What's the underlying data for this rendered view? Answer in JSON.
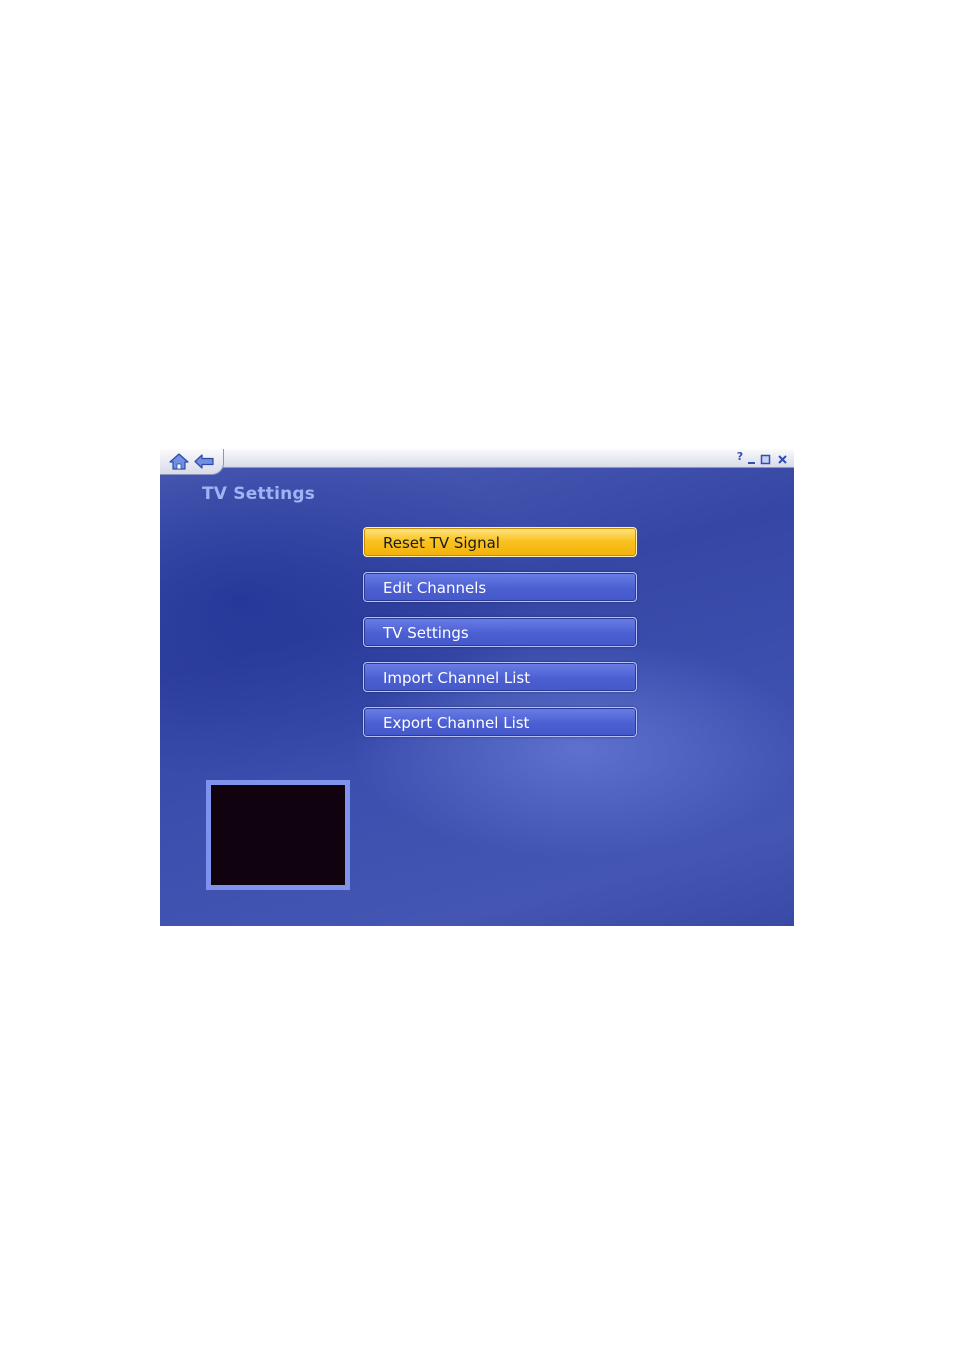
{
  "window": {
    "title": "TV Settings",
    "toolbar": {
      "home_icon": "home-icon",
      "back_icon": "back-arrow-icon"
    },
    "controls": {
      "help": "?",
      "minimize": "minimize-icon",
      "maximize": "maximize-icon",
      "close": "close-icon"
    }
  },
  "menu": {
    "selected_index": 0,
    "items": [
      {
        "label": "Reset TV Signal"
      },
      {
        "label": "Edit Channels"
      },
      {
        "label": "TV Settings"
      },
      {
        "label": "Import Channel List"
      },
      {
        "label": "Export Channel List"
      }
    ]
  },
  "colors": {
    "background": "#3c4fae",
    "title": "#9fb3f5",
    "button": "#4c5fd2",
    "button_selected": "#fac322",
    "preview_border": "#7f93ec",
    "preview": "#10020f"
  }
}
